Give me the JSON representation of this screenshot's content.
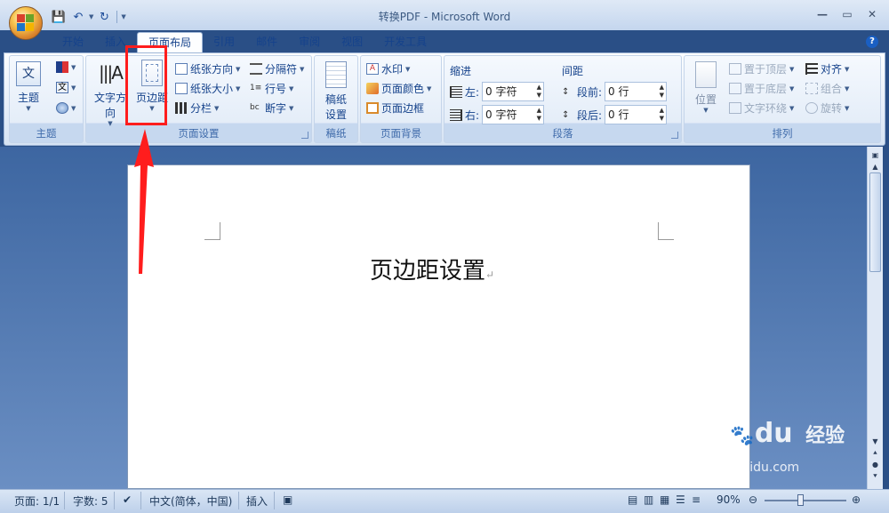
{
  "window": {
    "title": "转换PDF - Microsoft Word"
  },
  "qat": {
    "save": "💾",
    "undo": "↶",
    "redo": "↻"
  },
  "tabs": [
    "开始",
    "插入",
    "页面布局",
    "引用",
    "邮件",
    "审阅",
    "视图",
    "开发工具"
  ],
  "active_tab": "页面布局",
  "ribbon": {
    "theme": {
      "label": "主题",
      "group": "主题",
      "icon_text": "文"
    },
    "page_setup": {
      "group": "页面设置",
      "text_direction": "文字方向",
      "margins": "页边距",
      "orientation": "纸张方向",
      "size": "纸张大小",
      "columns": "分栏",
      "breaks": "分隔符",
      "line_numbers": "行号",
      "hyphenation": "断字"
    },
    "manuscript": {
      "group": "稿纸",
      "label_line1": "稿纸",
      "label_line2": "设置"
    },
    "page_background": {
      "group": "页面背景",
      "watermark": "水印",
      "page_color": "页面颜色",
      "page_borders": "页面边框"
    },
    "paragraph": {
      "group": "段落",
      "indent_title": "缩进",
      "left_label": "左:",
      "left_value": "0 字符",
      "right_label": "右:",
      "right_value": "0 字符",
      "spacing_title": "间距",
      "before_label": "段前:",
      "before_value": "0 行",
      "after_label": "段后:",
      "after_value": "0 行"
    },
    "arrange": {
      "group": "排列",
      "position": "位置",
      "bring_front": "置于顶层",
      "send_back": "置于底层",
      "text_wrap": "文字环绕",
      "align": "对齐",
      "group_btn": "组合",
      "rotate": "旋转"
    }
  },
  "document": {
    "text": "页边距设置",
    "para_mark": "↵"
  },
  "status": {
    "page": "页面: 1/1",
    "words": "字数: 5",
    "language": "中文(简体，中国)",
    "insert_mode": "插入",
    "zoom": "90%"
  },
  "watermark": {
    "brand": "Bai",
    "brand2": "du",
    "cn": "经验",
    "url": "jingyan.baidu.com"
  },
  "colors": {
    "annotation": "#ff1d1d",
    "accent": "#15428b"
  }
}
